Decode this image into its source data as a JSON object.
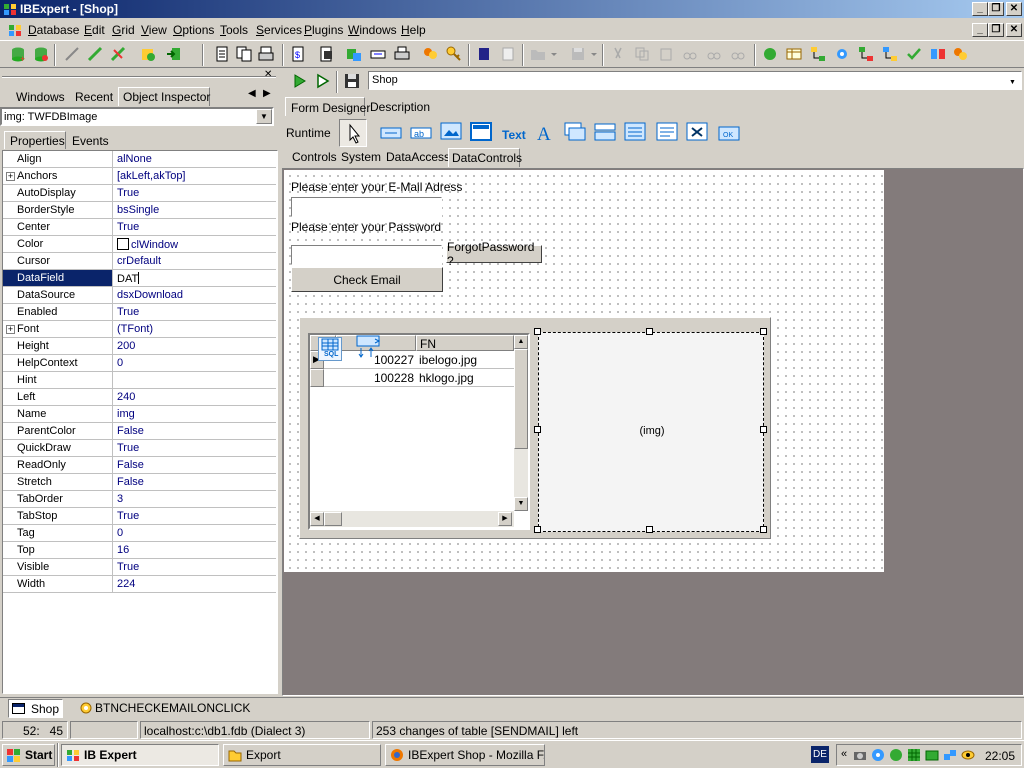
{
  "window": {
    "title": "IBExpert - [Shop]"
  },
  "menu": [
    "Database",
    "Edit",
    "Grid",
    "View",
    "Options",
    "Tools",
    "Services",
    "Plugins",
    "Windows",
    "Help"
  ],
  "left_panel": {
    "tabs": [
      "Windows",
      "Recent",
      "Object Inspector"
    ],
    "active_tab": "Object Inspector",
    "component_select": "img: TWFDBImage",
    "subtabs": [
      "Properties",
      "Events"
    ],
    "properties": [
      {
        "name": "Align",
        "value": "alNone"
      },
      {
        "name": "Anchors",
        "value": "[akLeft,akTop]",
        "expandable": true
      },
      {
        "name": "AutoDisplay",
        "value": "True"
      },
      {
        "name": "BorderStyle",
        "value": "bsSingle"
      },
      {
        "name": "Center",
        "value": "True"
      },
      {
        "name": "Color",
        "value": "clWindow",
        "swatch": "#ffffff"
      },
      {
        "name": "Cursor",
        "value": "crDefault"
      },
      {
        "name": "DataField",
        "value": "DAT",
        "selected": true
      },
      {
        "name": "DataSource",
        "value": "dsxDownload"
      },
      {
        "name": "Enabled",
        "value": "True"
      },
      {
        "name": "Font",
        "value": "(TFont)",
        "expandable": true
      },
      {
        "name": "Height",
        "value": "200"
      },
      {
        "name": "HelpContext",
        "value": "0"
      },
      {
        "name": "Hint",
        "value": ""
      },
      {
        "name": "Left",
        "value": "240"
      },
      {
        "name": "Name",
        "value": "img"
      },
      {
        "name": "ParentColor",
        "value": "False"
      },
      {
        "name": "QuickDraw",
        "value": "True"
      },
      {
        "name": "ReadOnly",
        "value": "False"
      },
      {
        "name": "Stretch",
        "value": "False"
      },
      {
        "name": "TabOrder",
        "value": "3"
      },
      {
        "name": "TabStop",
        "value": "True"
      },
      {
        "name": "Tag",
        "value": "0"
      },
      {
        "name": "Top",
        "value": "16"
      },
      {
        "name": "Visible",
        "value": "True"
      },
      {
        "name": "Width",
        "value": "224"
      }
    ]
  },
  "editor": {
    "name_field": "Shop",
    "tabs": [
      "Form Designer",
      "Description"
    ],
    "active_tab": "Form Designer",
    "runtime_label": "Runtime",
    "palette_tabs": [
      "Controls",
      "System",
      "DataAccess",
      "DataControls"
    ],
    "active_palette_tab": "DataControls",
    "palette_text_icon": "Text"
  },
  "form": {
    "email_label": "Please enter your E-Mail Adress",
    "password_label": "Please enter your Password",
    "forgot_button": "ForgotPassword ?",
    "check_button": "Check Email",
    "grid": {
      "column_header": "FN",
      "rows": [
        {
          "id": "100227",
          "fn": "ibelogo.jpg"
        },
        {
          "id": "100228",
          "fn": "hklogo.jpg"
        }
      ],
      "sql_icon_label": "SQL"
    },
    "image_label": "(img)"
  },
  "bottom_tabs": [
    "Shop",
    "BTNCHECKEMAILONCLICK"
  ],
  "status": {
    "position": "52:   45",
    "connection": "localhost:c:\\db1.fdb (Dialect 3)",
    "message": "253 changes of table [SENDMAIL] left"
  },
  "taskbar": {
    "start": "Start",
    "items": [
      "IB Expert",
      "Export",
      "IBExpert Shop - Mozilla F..."
    ],
    "lang": "DE",
    "clock": "22:05"
  },
  "colors": {
    "title_start": "#0a246a",
    "title_end": "#a6caf0",
    "selection": "#0a246a",
    "app_bg": "#d4d0c8",
    "workspace": "#837b7b"
  }
}
